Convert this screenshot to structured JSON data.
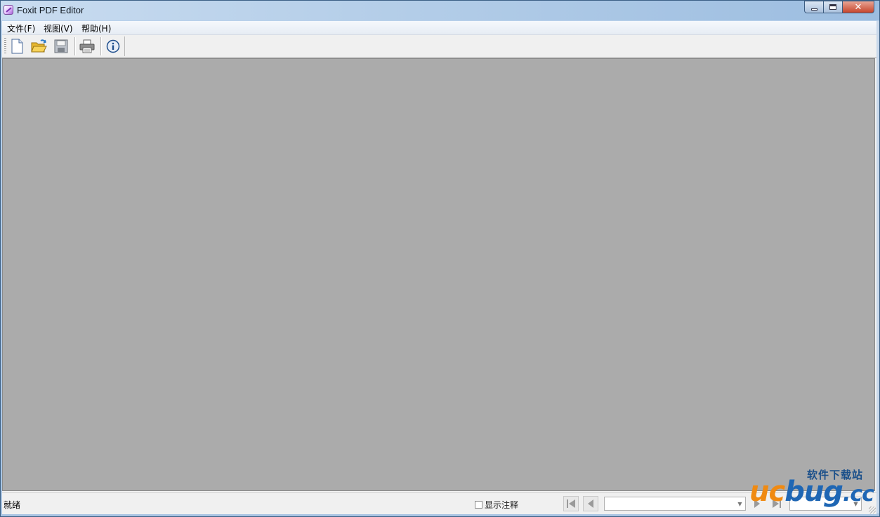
{
  "window": {
    "title": "Foxit PDF Editor",
    "close_glyph": "✕"
  },
  "menu": {
    "items": [
      {
        "label": "文件(F)"
      },
      {
        "label": "视图(V)"
      },
      {
        "label": "帮助(H)"
      }
    ]
  },
  "toolbar": {
    "buttons": [
      {
        "icon": "new-document-icon"
      },
      {
        "icon": "open-folder-icon"
      },
      {
        "icon": "save-icon"
      },
      {
        "icon": "print-icon"
      },
      {
        "icon": "info-icon"
      }
    ]
  },
  "status": {
    "text": "就绪",
    "show_annotations_label": "显示注释"
  },
  "watermark": {
    "top": "软件下载站",
    "uc": "uc",
    "bug": "bug",
    "cc": ".cc"
  },
  "colors": {
    "canvas": "#ababab",
    "title_bar": "#b9d1ea",
    "close_button": "#c7452c"
  }
}
